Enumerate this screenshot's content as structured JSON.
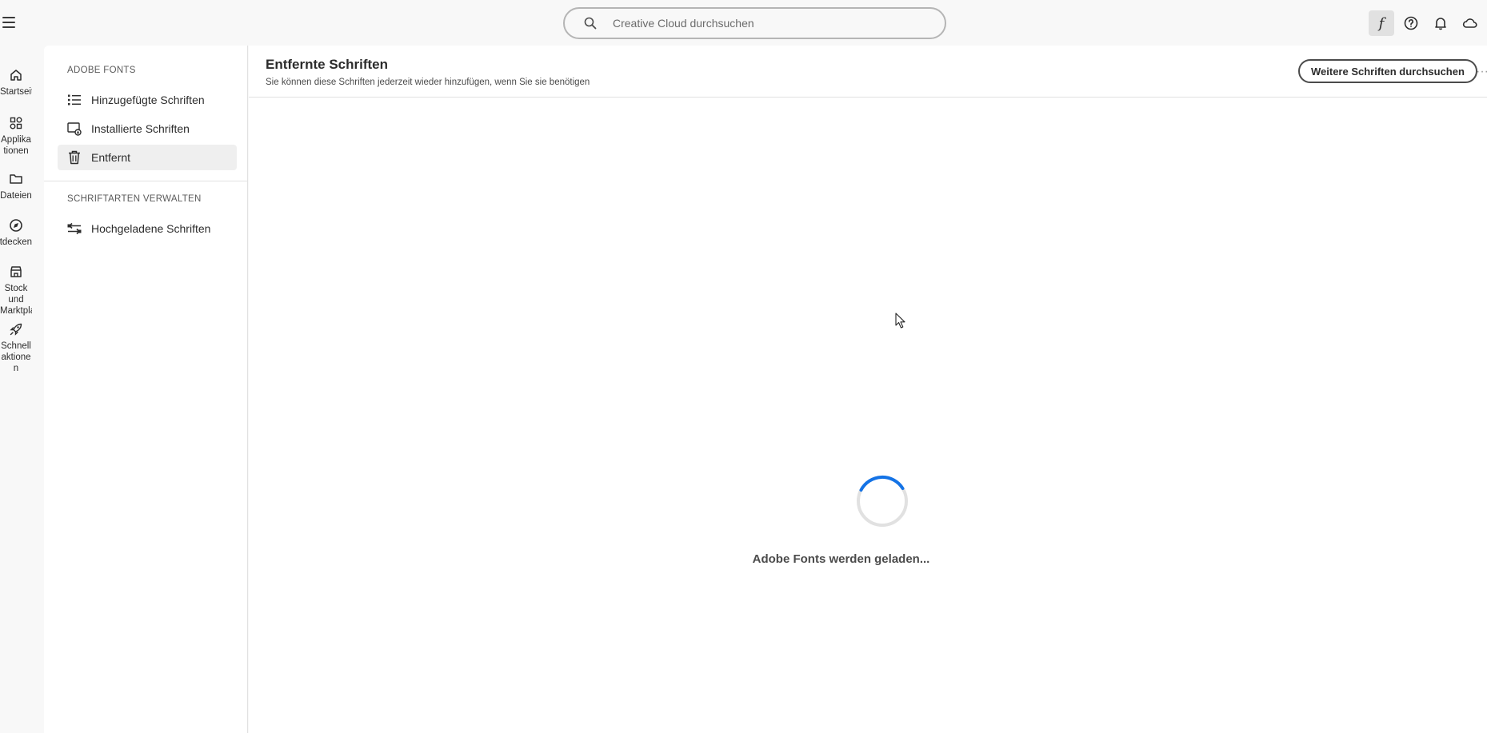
{
  "topbar": {
    "menu_icon": "hamburger-icon",
    "search": {
      "placeholder": "Creative Cloud durchsuchen",
      "value": ""
    },
    "icons": [
      "fonts-f-icon",
      "help-icon",
      "bell-icon",
      "cloud-icon"
    ],
    "fonts_glyph": "f"
  },
  "rail": {
    "items": [
      {
        "label": "Startseite",
        "icon": "home-icon"
      },
      {
        "label": "Applikationen",
        "icon": "apps-icon"
      },
      {
        "label": "Dateien",
        "icon": "folder-icon"
      },
      {
        "label": "Entdecken",
        "icon": "compass-icon"
      },
      {
        "label": "Stock und Marktplatz",
        "icon": "store-icon"
      },
      {
        "label": "Schnellaktionen",
        "icon": "rocket-icon"
      }
    ]
  },
  "sidebar": {
    "section1": "ADOBE FONTS",
    "items": [
      {
        "label": "Hinzugefügte Schriften",
        "icon": "list-icon"
      },
      {
        "label": "Installierte Schriften",
        "icon": "installed-icon"
      },
      {
        "label": "Entfernt",
        "icon": "trash-icon"
      }
    ],
    "section2": "SCHRIFTARTEN VERWALTEN",
    "items2": [
      {
        "label": "Hochgeladene Schriften",
        "icon": "transfer-icon"
      }
    ]
  },
  "main": {
    "title": "Entfernte Schriften",
    "subtitle": "Sie können diese Schriften jederzeit wieder hinzufügen, wenn Sie sie benötigen",
    "browse_button": "Weitere Schriften durchsuchen",
    "more_glyph": "···",
    "loading_text": "Adobe Fonts werden geladen..."
  },
  "colors": {
    "spinner_accent": "#1473e6",
    "spinner_track": "#e1e1e1",
    "selected_bg": "#efefef"
  }
}
